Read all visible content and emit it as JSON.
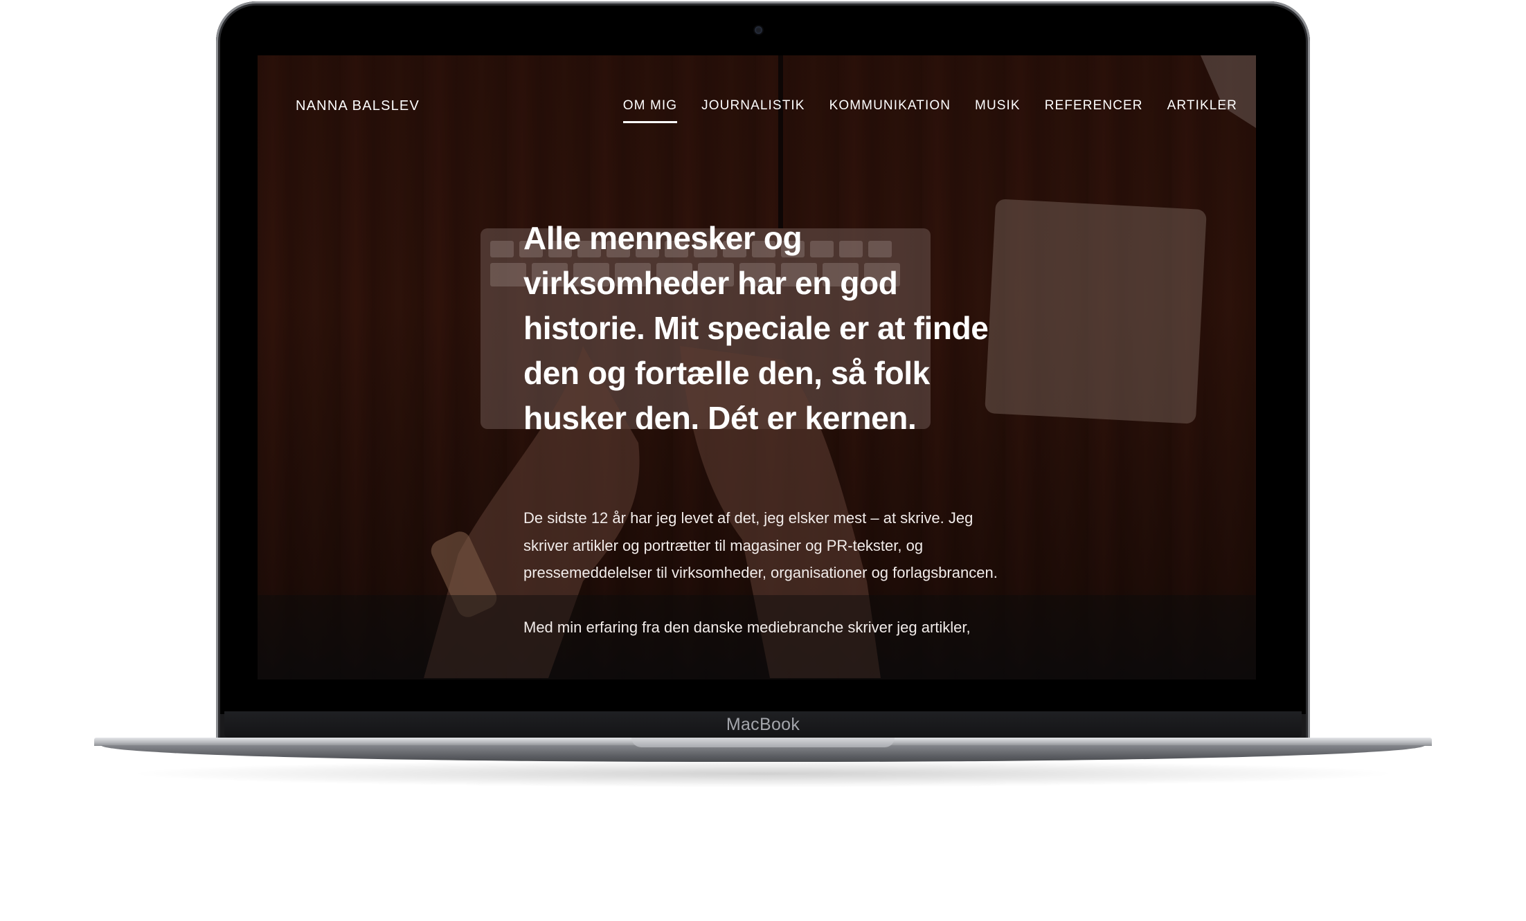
{
  "device": {
    "brand_label": "MacBook"
  },
  "site": {
    "title": "NANNA BALSLEV",
    "menu": [
      {
        "label": "OM MIG",
        "active": true
      },
      {
        "label": "JOURNALISTIK",
        "active": false
      },
      {
        "label": "KOMMUNIKATION",
        "active": false
      },
      {
        "label": "MUSIK",
        "active": false
      },
      {
        "label": "REFERENCER",
        "active": false
      },
      {
        "label": "ARTIKLER",
        "active": false
      }
    ]
  },
  "hero": {
    "headline": "Alle mennesker og virksomheder har en god historie. Mit speciale er at finde den og fortælle den, så folk husker den. Dét er kernen.",
    "paragraph_1": "De sidste 12 år har jeg levet af det, jeg elsker mest – at skrive. Jeg skriver artikler og portrætter til magasiner og PR-tekster, og pressemeddelelser til virksomheder, organisationer og forlagsbrancen.",
    "paragraph_2": "Med min erfaring fra den danske mediebranche skriver jeg artikler,"
  },
  "colors": {
    "background": "#ffffff",
    "screen_tint": "#31140b",
    "text": "#ffffff",
    "bezel": "#000000"
  }
}
